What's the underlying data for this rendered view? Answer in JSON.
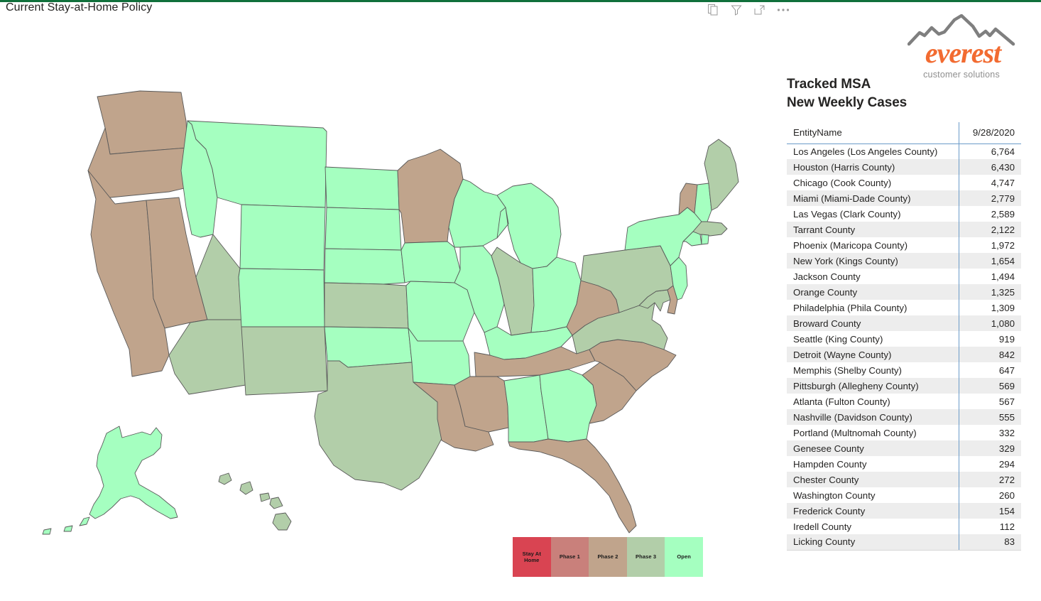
{
  "top_bar_color": "#10703B",
  "header": {
    "visual_title": "Current Stay-at-Home Policy",
    "actions": [
      {
        "name": "copy-icon",
        "label": "Copy visual"
      },
      {
        "name": "filter-icon",
        "label": "Filters"
      },
      {
        "name": "focus-mode-icon",
        "label": "Focus mode"
      },
      {
        "name": "more-options-icon",
        "label": "More options"
      }
    ]
  },
  "logo": {
    "wordmark": "everest",
    "tagline": "customer solutions",
    "wordmark_color": "#F26B31",
    "tagline_color": "#8E8E8E",
    "mountain_color": "#808080"
  },
  "panel": {
    "title_line1": "Tracked MSA",
    "title_line2": "New Weekly Cases",
    "columns": [
      "EntityName",
      "9/28/2020"
    ],
    "rows": [
      {
        "name": "Los Angeles (Los Angeles County)",
        "value": "6,764"
      },
      {
        "name": "Houston (Harris County)",
        "value": "6,430"
      },
      {
        "name": "Chicago (Cook County)",
        "value": "4,747"
      },
      {
        "name": "Miami (Miami-Dade County)",
        "value": "2,779"
      },
      {
        "name": "Las Vegas (Clark County)",
        "value": "2,589"
      },
      {
        "name": "Tarrant County",
        "value": "2,122"
      },
      {
        "name": "Phoenix (Maricopa County)",
        "value": "1,972"
      },
      {
        "name": "New York (Kings County)",
        "value": "1,654"
      },
      {
        "name": "Jackson County",
        "value": "1,494"
      },
      {
        "name": "Orange County",
        "value": "1,325"
      },
      {
        "name": "Philadelphia (Phila County)",
        "value": "1,309"
      },
      {
        "name": "Broward County",
        "value": "1,080"
      },
      {
        "name": "Seattle (King County)",
        "value": "919"
      },
      {
        "name": "Detroit (Wayne County)",
        "value": "842"
      },
      {
        "name": "Memphis (Shelby County)",
        "value": "647"
      },
      {
        "name": "Pittsburgh (Allegheny County)",
        "value": "569"
      },
      {
        "name": "Atlanta (Fulton County)",
        "value": "567"
      },
      {
        "name": "Nashville (Davidson County)",
        "value": "555"
      },
      {
        "name": "Portland (Multnomah County)",
        "value": "332"
      },
      {
        "name": "Genesee County",
        "value": "329"
      },
      {
        "name": "Hampden County",
        "value": "294"
      },
      {
        "name": "Chester County",
        "value": "272"
      },
      {
        "name": "Washington County",
        "value": "260"
      },
      {
        "name": "Frederick County",
        "value": "154"
      },
      {
        "name": "Iredell County",
        "value": "112"
      },
      {
        "name": "Licking County",
        "value": "83"
      }
    ]
  },
  "legend": {
    "segments": [
      {
        "label": "Stay At Home",
        "label_line1": "Stay At",
        "label_line2": "Home",
        "color": "#D94452"
      },
      {
        "label": "Phase 1",
        "label_line1": "Phase 1",
        "label_line2": "",
        "color": "#C9807B"
      },
      {
        "label": "Phase 2",
        "label_line1": "Phase 2",
        "label_line2": "",
        "color": "#C0A48C"
      },
      {
        "label": "Phase 3",
        "label_line1": "Phase 3",
        "label_line2": "",
        "color": "#B2CEA9"
      },
      {
        "label": "Open",
        "label_line1": "Open",
        "label_line2": "",
        "color": "#A5FFC0"
      }
    ]
  },
  "map": {
    "border_color": "#595959",
    "phase_colors": {
      "stay_at_home": "#D94452",
      "phase1": "#C9807B",
      "phase2": "#C0A48C",
      "phase3": "#B2CEA9",
      "open": "#A5FFC0"
    },
    "states": [
      {
        "code": "WA",
        "name": "Washington",
        "phase": "Phase 2"
      },
      {
        "code": "OR",
        "name": "Oregon",
        "phase": "Phase 2"
      },
      {
        "code": "CA",
        "name": "California",
        "phase": "Phase 2"
      },
      {
        "code": "NV",
        "name": "Nevada",
        "phase": "Phase 2"
      },
      {
        "code": "ID",
        "name": "Idaho",
        "phase": "Open"
      },
      {
        "code": "MT",
        "name": "Montana",
        "phase": "Open"
      },
      {
        "code": "WY",
        "name": "Wyoming",
        "phase": "Open"
      },
      {
        "code": "UT",
        "name": "Utah",
        "phase": "Phase 3"
      },
      {
        "code": "AZ",
        "name": "Arizona",
        "phase": "Phase 3"
      },
      {
        "code": "NM",
        "name": "New Mexico",
        "phase": "Phase 3"
      },
      {
        "code": "CO",
        "name": "Colorado",
        "phase": "Open"
      },
      {
        "code": "ND",
        "name": "North Dakota",
        "phase": "Open"
      },
      {
        "code": "SD",
        "name": "South Dakota",
        "phase": "Open"
      },
      {
        "code": "NE",
        "name": "Nebraska",
        "phase": "Open"
      },
      {
        "code": "KS",
        "name": "Kansas",
        "phase": "Phase 3"
      },
      {
        "code": "OK",
        "name": "Oklahoma",
        "phase": "Open"
      },
      {
        "code": "TX",
        "name": "Texas",
        "phase": "Phase 3"
      },
      {
        "code": "MN",
        "name": "Minnesota",
        "phase": "Phase 2"
      },
      {
        "code": "IA",
        "name": "Iowa",
        "phase": "Open"
      },
      {
        "code": "MO",
        "name": "Missouri",
        "phase": "Open"
      },
      {
        "code": "AR",
        "name": "Arkansas",
        "phase": "Open"
      },
      {
        "code": "LA",
        "name": "Louisiana",
        "phase": "Phase 2"
      },
      {
        "code": "WI",
        "name": "Wisconsin",
        "phase": "Open"
      },
      {
        "code": "IL",
        "name": "Illinois",
        "phase": "Open"
      },
      {
        "code": "MI",
        "name": "Michigan",
        "phase": "Open"
      },
      {
        "code": "IN",
        "name": "Indiana",
        "phase": "Phase 3"
      },
      {
        "code": "OH",
        "name": "Ohio",
        "phase": "Open"
      },
      {
        "code": "KY",
        "name": "Kentucky",
        "phase": "Open"
      },
      {
        "code": "TN",
        "name": "Tennessee",
        "phase": "Phase 2"
      },
      {
        "code": "MS",
        "name": "Mississippi",
        "phase": "Phase 2"
      },
      {
        "code": "AL",
        "name": "Alabama",
        "phase": "Open"
      },
      {
        "code": "GA",
        "name": "Georgia",
        "phase": "Open"
      },
      {
        "code": "FL",
        "name": "Florida",
        "phase": "Phase 2"
      },
      {
        "code": "SC",
        "name": "South Carolina",
        "phase": "Phase 2"
      },
      {
        "code": "NC",
        "name": "North Carolina",
        "phase": "Phase 2"
      },
      {
        "code": "VA",
        "name": "Virginia",
        "phase": "Phase 3"
      },
      {
        "code": "WV",
        "name": "West Virginia",
        "phase": "Phase 2"
      },
      {
        "code": "MD",
        "name": "Maryland",
        "phase": "Phase 3"
      },
      {
        "code": "DE",
        "name": "Delaware",
        "phase": "Phase 2"
      },
      {
        "code": "PA",
        "name": "Pennsylvania",
        "phase": "Phase 3"
      },
      {
        "code": "NJ",
        "name": "New Jersey",
        "phase": "Open"
      },
      {
        "code": "NY",
        "name": "New York",
        "phase": "Open"
      },
      {
        "code": "CT",
        "name": "Connecticut",
        "phase": "Open"
      },
      {
        "code": "RI",
        "name": "Rhode Island",
        "phase": "Open"
      },
      {
        "code": "MA",
        "name": "Massachusetts",
        "phase": "Phase 3"
      },
      {
        "code": "VT",
        "name": "Vermont",
        "phase": "Phase 2"
      },
      {
        "code": "NH",
        "name": "New Hampshire",
        "phase": "Open"
      },
      {
        "code": "ME",
        "name": "Maine",
        "phase": "Phase 3"
      },
      {
        "code": "AK",
        "name": "Alaska",
        "phase": "Open"
      },
      {
        "code": "HI",
        "name": "Hawaii",
        "phase": "Phase 3"
      }
    ]
  }
}
